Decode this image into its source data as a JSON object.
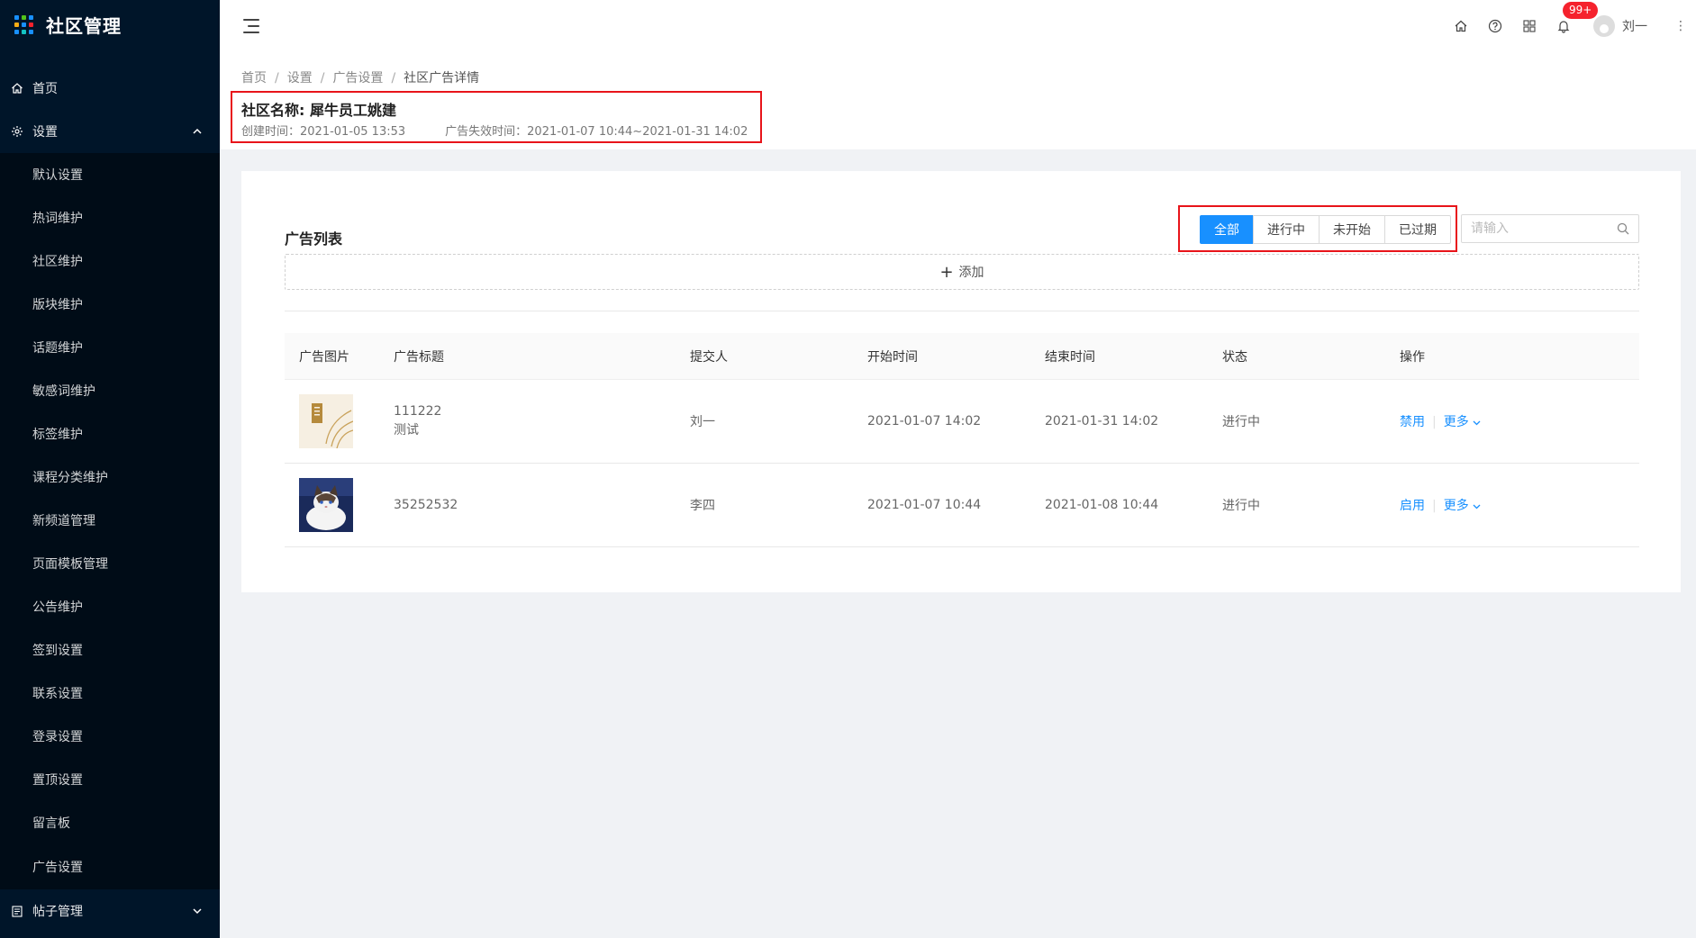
{
  "app": {
    "title": "社区管理"
  },
  "sidebar": {
    "home": "首页",
    "settings": "设置",
    "settings_items": [
      "默认设置",
      "热词维护",
      "社区维护",
      "版块维护",
      "话题维护",
      "敏感词维护",
      "标签维护",
      "课程分类维护",
      "新频道管理",
      "页面模板管理",
      "公告维护",
      "签到设置",
      "联系设置",
      "登录设置",
      "置顶设置",
      "留言板",
      "广告设置"
    ],
    "posts": "帖子管理"
  },
  "header": {
    "notification_badge": "99+",
    "username": "刘一",
    "icons": [
      "menu-fold-icon",
      "home-icon",
      "question-icon",
      "app-grid-icon",
      "bell-icon",
      "avatar-icon",
      "more-vertical-icon"
    ]
  },
  "breadcrumb": [
    "首页",
    "设置",
    "广告设置",
    "社区广告详情"
  ],
  "community": {
    "name_label": "社区名称:",
    "name": "犀牛员工姚建",
    "created": "创建时间：2021-01-05 13:53",
    "expire": "广告失效时间：2021-01-07 10:44~2021-01-31 14:02"
  },
  "ad_list": {
    "title": "广告列表",
    "filters": [
      "全部",
      "进行中",
      "未开始",
      "已过期"
    ],
    "active_filter": "全部",
    "search_placeholder": "请输入",
    "add_label": "添加",
    "columns": [
      "广告图片",
      "广告标题",
      "提交人",
      "开始时间",
      "结束时间",
      "状态",
      "操作"
    ],
    "rows": [
      {
        "title": "111222",
        "subtitle": "测试",
        "submitter": "刘一",
        "start": "2021-01-07 14:02",
        "end": "2021-01-31 14:02",
        "status": "进行中",
        "action": "禁用",
        "more": "更多"
      },
      {
        "title": "35252532",
        "subtitle": "",
        "submitter": "李四",
        "start": "2021-01-07 10:44",
        "end": "2021-01-08 10:44",
        "status": "进行中",
        "action": "启用",
        "more": "更多"
      }
    ]
  },
  "colors": {
    "sidebar_bg": "#001529",
    "primary": "#1890ff",
    "highlight_border": "#e8141a",
    "badge": "#f5222d"
  }
}
